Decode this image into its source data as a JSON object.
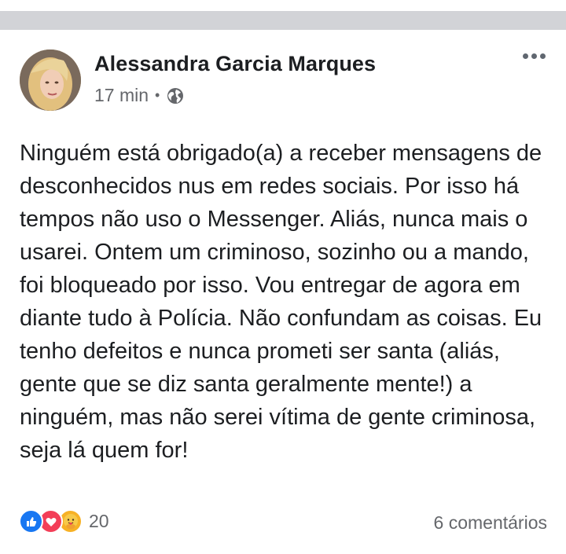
{
  "post": {
    "author": "Alessandra Garcia Marques",
    "time": "17 min",
    "separator": "•",
    "privacy_icon": "globe-icon",
    "menu_icon": "more-options-icon",
    "text": "Ninguém está obrigado(a) a receber mensagens de desconhecidos nus em redes sociais. Por isso há tempos não uso o Messenger. Aliás, nunca mais o usarei. Ontem um criminoso, sozinho ou a mando, foi bloqueado por isso. Vou entregar de agora em diante tudo à Polícia. Não confundam as coisas. Eu tenho defeitos e nunca prometi ser santa (aliás, gente que se diz santa geralmente mente!) a ninguém, mas não serei vítima de gente criminosa, seja lá quem for!"
  },
  "footer": {
    "reaction_icons": [
      "like-icon",
      "love-icon",
      "care-icon"
    ],
    "reaction_count": "20",
    "comments": "6 comentários"
  },
  "colors": {
    "like": "#1877f2",
    "love": "#f33e58",
    "care": "#f7b125",
    "secondary_text": "#65676b"
  }
}
